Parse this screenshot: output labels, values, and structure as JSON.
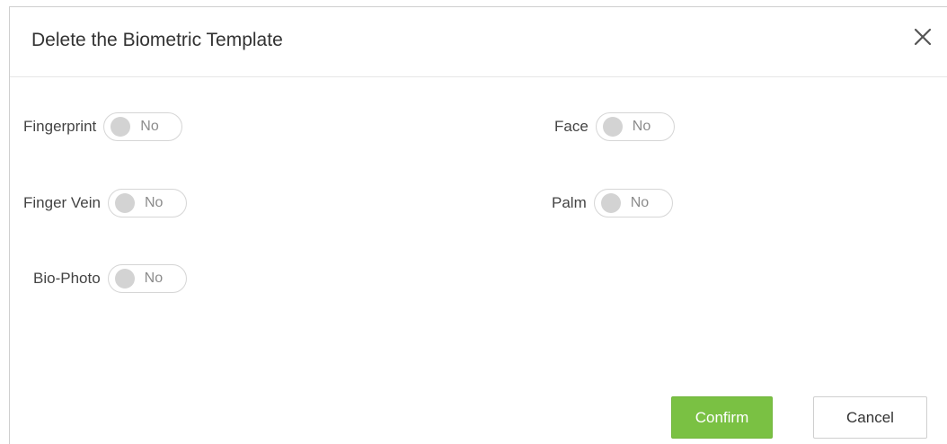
{
  "dialog": {
    "title": "Delete the Biometric Template",
    "close_icon": "close-icon"
  },
  "options": {
    "fingerprint": {
      "label": "Fingerprint",
      "value": "No"
    },
    "face": {
      "label": "Face",
      "value": "No"
    },
    "finger_vein": {
      "label": "Finger Vein",
      "value": "No"
    },
    "palm": {
      "label": "Palm",
      "value": "No"
    },
    "bio_photo": {
      "label": "Bio-Photo",
      "value": "No"
    }
  },
  "buttons": {
    "confirm_label": "Confirm",
    "cancel_label": "Cancel"
  },
  "colors": {
    "confirm_bg": "#7ac143",
    "toggle_off_knob": "#d3d3d3"
  }
}
